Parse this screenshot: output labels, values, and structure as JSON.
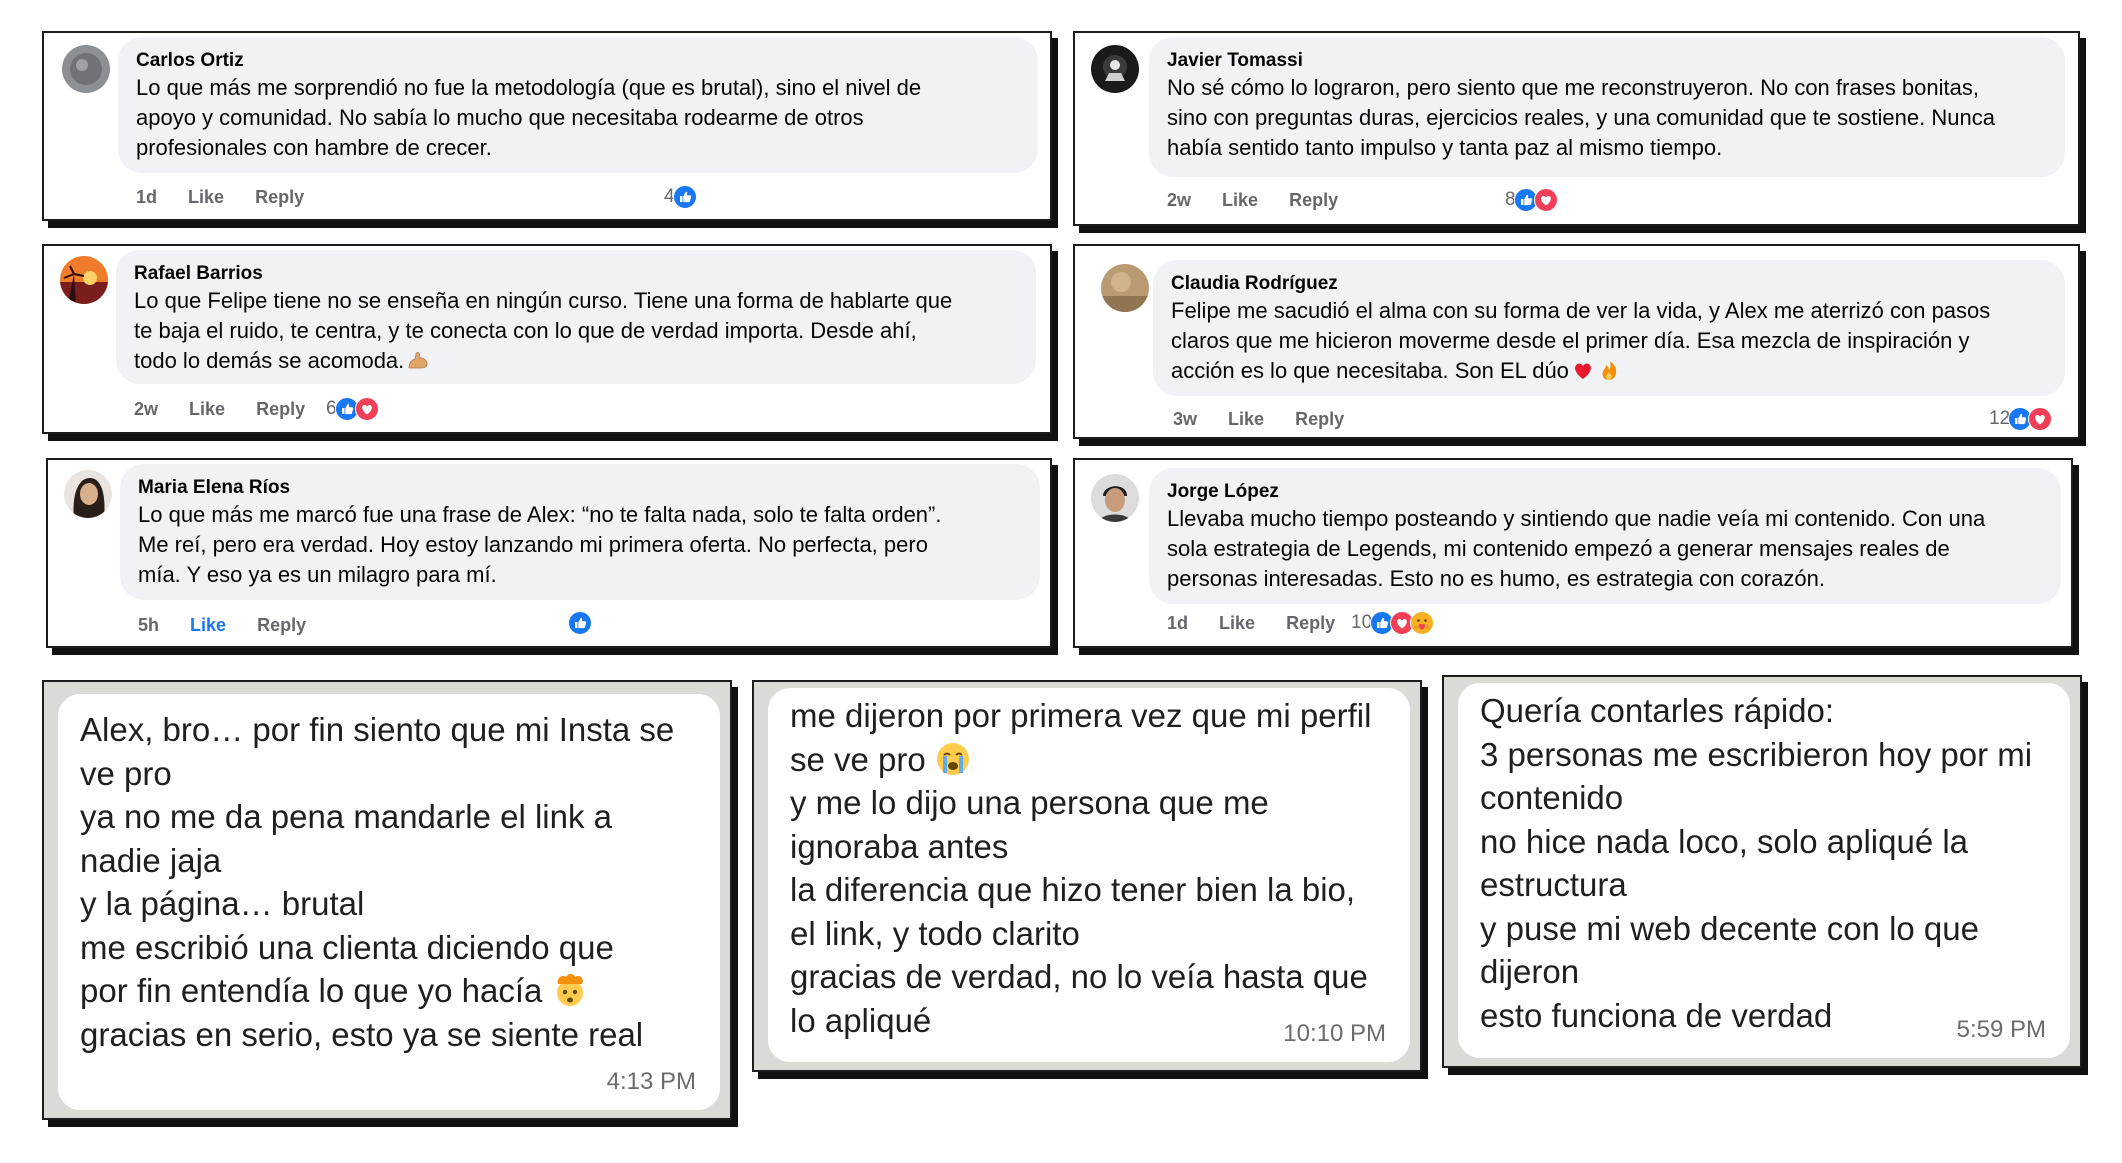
{
  "colors": {
    "fb_blue": "#1877f2",
    "love_red": "#f33e58",
    "bubble_gray": "#f0f2f5",
    "wa_bg": "#dcdad6"
  },
  "fb": {
    "like_label": "Like",
    "reply_label": "Reply",
    "comments": [
      {
        "name": "Carlos Ortiz",
        "avatar": "stone-avatar",
        "lines": [
          "Lo que más me sorprendió no fue la metodología (que es brutal), sino el nivel de",
          "apoyo y comunidad. No sabía lo mucho que necesitaba rodearme de otros",
          "profesionales con hambre de crecer."
        ],
        "time": "1d",
        "count": "4",
        "reactions": [
          "like"
        ]
      },
      {
        "name": "Javier Tomassi",
        "avatar": "dark-logo-avatar",
        "lines": [
          "No sé cómo lo lograron, pero siento que me reconstruyeron. No con frases bonitas,",
          "sino con preguntas duras, ejercicios reales, y una comunidad que te sostiene. Nunca",
          "había sentido tanto impulso y tanta paz al mismo tiempo."
        ],
        "time": "2w",
        "count": "8",
        "reactions": [
          "like",
          "love"
        ]
      },
      {
        "name": "Rafael Barrios",
        "avatar": "sunset-avatar",
        "lines": [
          "Lo que Felipe tiene no se enseña en ningún curso. Tiene una forma de hablarte que",
          "te baja el ruido, te centra, y te conecta con lo que de verdad importa. Desde ahí,",
          "todo lo demás se acomoda."
        ],
        "time": "2w",
        "count": "6",
        "reactions": [
          "like",
          "love"
        ]
      },
      {
        "name": "Claudia Rodríguez",
        "avatar": "sand-avatar",
        "lines": [
          "Felipe me sacudió el alma con su forma de ver la vida, y Alex me aterrizó con pasos",
          "claros que me hicieron moverme desde el primer día. Esa mezcla de inspiración y",
          "acción es lo que necesitaba. Son EL dúo"
        ],
        "time": "3w",
        "count": "12",
        "reactions": [
          "like",
          "love"
        ]
      },
      {
        "name": "Maria Elena Ríos",
        "avatar": "portrait-avatar",
        "lines": [
          "Lo que más me marcó fue una frase de Alex: “no te falta nada, solo te falta orden”.",
          "Me reí, pero era verdad. Hoy estoy lanzando mi primera oferta. No perfecta, pero",
          "mía. Y eso ya es un milagro para mí."
        ],
        "time": "5h",
        "count": "",
        "reactions": [
          "like"
        ]
      },
      {
        "name": "Jorge López",
        "avatar": "man-avatar",
        "lines": [
          "Llevaba mucho tiempo posteando y sintiendo que nadie veía mi contenido. Con una",
          "sola estrategia de Legends, mi contenido empezó a generar mensajes reales de",
          "personas interesadas. Esto no es humo, es estrategia con corazón."
        ],
        "time": "1d",
        "count": "10",
        "reactions": [
          "like",
          "love",
          "care"
        ]
      }
    ]
  },
  "wa": {
    "messages": [
      {
        "lines": [
          "Alex, bro… por fin siento que mi Insta se",
          "ve pro",
          "ya no me da pena mandarle el link a",
          "nadie jaja",
          "y la página… brutal",
          "me escribió una clienta diciendo que",
          "por fin entendía lo que yo hacía",
          "gracias en serio, esto ya se siente real"
        ],
        "time": "4:13 PM"
      },
      {
        "lines": [
          "me dijeron por primera vez que mi perfil",
          "se ve pro",
          "y me lo dijo una persona que me",
          "ignoraba antes",
          "la diferencia que hizo tener bien la bio,",
          "el link, y todo clarito",
          "gracias de verdad, no lo veía hasta que",
          "lo apliqué"
        ],
        "time": "10:10 PM"
      },
      {
        "lines": [
          "Quería contarles rápido:",
          "3 personas me escribieron hoy por mi",
          "contenido",
          "no hice nada loco, solo apliqué la",
          "estructura",
          "y puse mi web decente con lo que",
          "dijeron",
          "esto funciona de verdad"
        ],
        "time": "5:59 PM"
      }
    ]
  },
  "icons": {
    "like": "like-reaction-icon",
    "love": "love-reaction-icon",
    "care": "care-reaction-icon",
    "flexed_biceps": "flexed-biceps-emoji",
    "heart": "red-heart-emoji",
    "fire": "fire-emoji",
    "crying": "loudly-crying-emoji",
    "exploding_head": "exploding-head-emoji"
  }
}
